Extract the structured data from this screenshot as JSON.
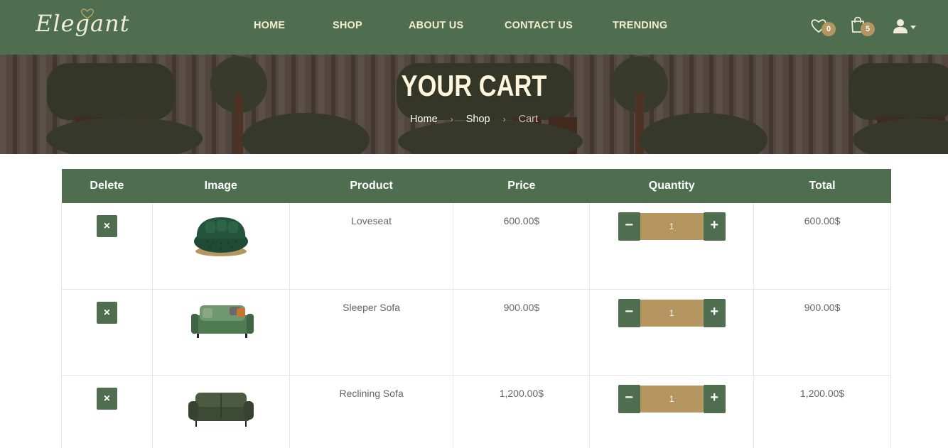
{
  "brand": {
    "name": "Elegant"
  },
  "nav": {
    "items": [
      {
        "label": "HOME"
      },
      {
        "label": "SHOP"
      },
      {
        "label": "ABOUT US"
      },
      {
        "label": "CONTACT US"
      },
      {
        "label": "TRENDING"
      }
    ]
  },
  "header_icons": {
    "wishlist": {
      "icon": "heart-icon",
      "count": "0"
    },
    "cart": {
      "icon": "shopping-bag-icon",
      "count": "5"
    },
    "account": {
      "icon": "user-icon"
    }
  },
  "hero": {
    "title": "YOUR CART",
    "breadcrumb": [
      "Home",
      "Shop",
      "Cart"
    ]
  },
  "table": {
    "headers": [
      "Delete",
      "Image",
      "Product",
      "Price",
      "Quantity",
      "Total"
    ],
    "rows": [
      {
        "product": "Loveseat",
        "price": "600.00$",
        "quantity": "1",
        "total": "600.00$"
      },
      {
        "product": "Sleeper Sofa",
        "price": "900.00$",
        "quantity": "1",
        "total": "900.00$"
      },
      {
        "product": "Reclining Sofa",
        "price": "1,200.00$",
        "quantity": "1",
        "total": "1,200.00$"
      }
    ],
    "delete_symbol": "×",
    "minus_symbol": "−",
    "plus_symbol": "+"
  },
  "colors": {
    "primary_green": "#4f6e4f",
    "accent_gold": "#b59560",
    "nav_text": "#f3eccf"
  }
}
